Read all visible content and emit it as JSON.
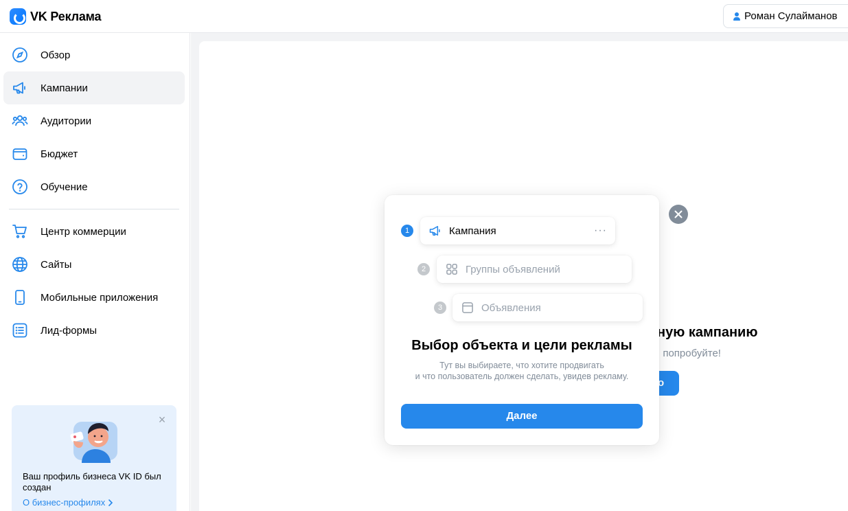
{
  "app": {
    "title": "VK Реклама"
  },
  "user": {
    "name": "Роман Сулайманов"
  },
  "sidebar": {
    "items": [
      {
        "label": "Обзор",
        "icon": "compass-icon"
      },
      {
        "label": "Кампании",
        "icon": "megaphone-icon",
        "active": true
      },
      {
        "label": "Аудитории",
        "icon": "users-icon"
      },
      {
        "label": "Бюджет",
        "icon": "wallet-icon"
      },
      {
        "label": "Обучение",
        "icon": "question-icon"
      },
      {
        "label": "Центр коммерции",
        "icon": "cart-icon"
      },
      {
        "label": "Сайты",
        "icon": "globe-icon"
      },
      {
        "label": "Мобильные приложения",
        "icon": "phone-icon"
      },
      {
        "label": "Лид-формы",
        "icon": "list-icon"
      }
    ],
    "promo": {
      "text": "Ваш профиль бизнеса VK ID был создан",
      "link": "О бизнес-профилях"
    }
  },
  "background": {
    "title": "ную кампанию",
    "subtitle": ", попробуйте!",
    "button_label": "о"
  },
  "modal": {
    "steps": [
      {
        "number": "1",
        "label": "Кампания",
        "icon": "megaphone-icon",
        "active": true
      },
      {
        "number": "2",
        "label": "Группы объявлений",
        "icon": "grid-icon",
        "active": false
      },
      {
        "number": "3",
        "label": "Объявления",
        "icon": "ad-icon",
        "active": false
      }
    ],
    "more": "···",
    "title": "Выбор объекта и цели рекламы",
    "description_line1": "Тут вы выбираете, что хотите продвигать",
    "description_line2": "и что пользователь должен сделать, увидев рекламу.",
    "button_label": "Далее"
  },
  "colors": {
    "accent": "#2688eb",
    "muted": "#818c99",
    "bg": "#f2f3f5"
  }
}
